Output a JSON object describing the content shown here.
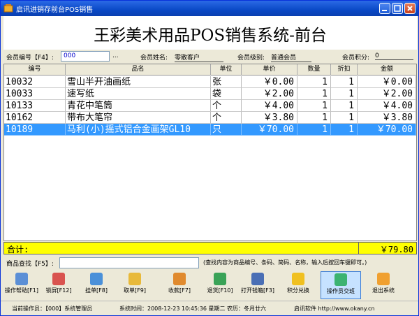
{
  "window": {
    "title": "启讯进销存前台POS销售"
  },
  "header": {
    "title": "王彩美术用品POS销售系统-前台"
  },
  "member": {
    "num_label": "会员编号【F4】:",
    "num_value": "000",
    "dots": "...",
    "name_label": "会员姓名:",
    "name_value": "零散客户",
    "level_label": "会员级别:",
    "level_value": "普通会员",
    "points_label": "会员积分:",
    "points_value": "0"
  },
  "table": {
    "columns": [
      "编号",
      "品名",
      "单位",
      "单价",
      "数量",
      "折扣",
      "金额"
    ],
    "rows": [
      {
        "code": "10032",
        "name": "雪山半开油画纸",
        "unit": "张",
        "price": "￥0.00",
        "qty": "1",
        "disc": "1",
        "amount": "￥0.00"
      },
      {
        "code": "10033",
        "name": "速写纸",
        "unit": "袋",
        "price": "￥2.00",
        "qty": "1",
        "disc": "1",
        "amount": "￥2.00"
      },
      {
        "code": "10133",
        "name": "青花中笔筒",
        "unit": "个",
        "price": "￥4.00",
        "qty": "1",
        "disc": "1",
        "amount": "￥4.00"
      },
      {
        "code": "10162",
        "name": "带布大笔帘",
        "unit": "个",
        "price": "￥3.80",
        "qty": "1",
        "disc": "1",
        "amount": "￥3.80"
      },
      {
        "code": "10189",
        "name": "马利(小)摇式铝合金画架GL10",
        "unit": "只",
        "price": "￥70.00",
        "qty": "1",
        "disc": "1",
        "amount": "￥70.00"
      }
    ]
  },
  "total": {
    "label": "合计:",
    "value": "￥79.80"
  },
  "search": {
    "label": "商品查找【F5】:",
    "dots": "...",
    "hint": "(查找内容为商品编号、条码、简码、名称，输入后按回车键即可。)"
  },
  "toolbar": [
    {
      "label": "操作帮助[F1]",
      "icon": "help-icon",
      "color": "#5b8fd6"
    },
    {
      "label": "锁屏[F12]",
      "icon": "lock-icon",
      "color": "#d9534f"
    },
    {
      "label": "挂单[F8]",
      "icon": "hang-order-icon",
      "color": "#4a90d9"
    },
    {
      "label": "取单[F9]",
      "icon": "retrieve-order-icon",
      "color": "#e8b93a"
    },
    {
      "label": "收款[F7]",
      "icon": "cash-register-icon",
      "color": "#e08a2e"
    },
    {
      "label": "退货[F10]",
      "icon": "return-goods-icon",
      "color": "#3aa357"
    },
    {
      "label": "打开钱箱[F3]",
      "icon": "cash-drawer-icon",
      "color": "#4a6fb5"
    },
    {
      "label": "积分兑换",
      "icon": "points-exchange-icon",
      "color": "#f0c020"
    },
    {
      "label": "操作员交班",
      "icon": "shift-handover-icon",
      "color": "#3cb371"
    },
    {
      "label": "退出系统",
      "icon": "exit-icon",
      "color": "#f0a030"
    }
  ],
  "status": {
    "operator": "当前操作员：【000】系统管理员",
    "time": "系统时间：2008-12-23 10:45:36 星期二 农历：冬月廿六",
    "company": "启讯软件 http://www.okany.cn"
  }
}
